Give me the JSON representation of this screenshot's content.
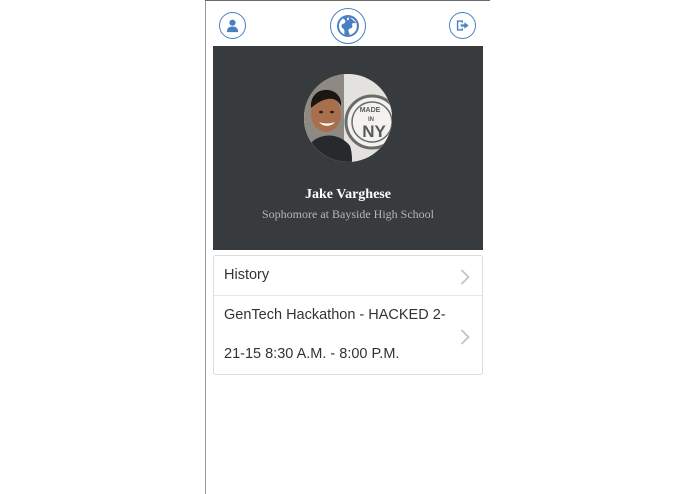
{
  "nav": {
    "profile_icon": "user-icon",
    "globe_icon": "globe-icon",
    "logout_icon": "logout-icon",
    "accent_color": "#4a7fc1"
  },
  "profile": {
    "name": "Jake Varghese",
    "subtitle": "Sophomore at Bayside High School",
    "avatar_badge_text": "MADE IN NY",
    "card_color": "#373b3e"
  },
  "list": {
    "items": [
      {
        "label": "History"
      },
      {
        "label": "GenTech Hackathon - HACKED 2-21-15 8:30 A.M. - 8:00 P.M."
      }
    ]
  }
}
